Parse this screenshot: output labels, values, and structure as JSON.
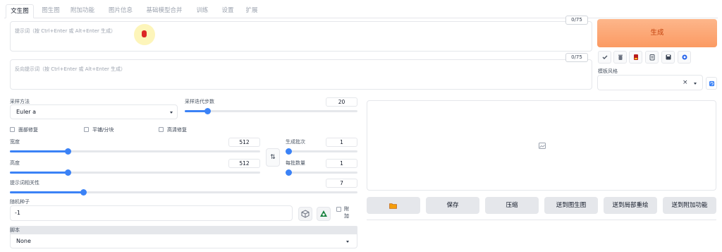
{
  "tabs": [
    {
      "label": "文生图",
      "active": true
    },
    {
      "label": "图生图"
    },
    {
      "label": "附加功能"
    },
    {
      "label": "图片信息"
    },
    {
      "label": "基础模型合并"
    },
    {
      "label": "训练"
    },
    {
      "label": "设置"
    },
    {
      "label": "扩展"
    }
  ],
  "prompt": {
    "placeholder": "提示词（按 Ctrl+Enter 或 Alt+Enter 生成）",
    "counter": "0/75"
  },
  "negative_prompt": {
    "placeholder": "反向提示词（按 Ctrl+Enter 或 Alt+Enter 生成）",
    "counter": "0/75"
  },
  "generate_button": "生成",
  "toolbar_icons": [
    "checkmark-icon",
    "trash-icon",
    "card-icon",
    "clipboard-icon",
    "save-icon",
    "refresh-icon"
  ],
  "styles": {
    "label": "模板风格",
    "clear": "×",
    "refresh_icon": "refresh-icon"
  },
  "sampler": {
    "label": "采样方法",
    "value": "Euler a"
  },
  "steps": {
    "label": "采样迭代步数",
    "value": "20",
    "progress": 0.13
  },
  "checkboxes": [
    {
      "label": "面部修复",
      "checked": false
    },
    {
      "label": "平铺/分块",
      "checked": false
    },
    {
      "label": "高清修复",
      "checked": false
    }
  ],
  "width": {
    "label": "宽度",
    "value": "512",
    "progress": 0.23
  },
  "height": {
    "label": "高度",
    "value": "512",
    "progress": 0.23
  },
  "batch_count": {
    "label": "生成批次",
    "value": "1",
    "progress": 0.0
  },
  "batch_size": {
    "label": "每批数量",
    "value": "1",
    "progress": 0.0
  },
  "cfg": {
    "label": "提示词相关性",
    "value": "7",
    "progress": 0.21
  },
  "seed": {
    "label": "随机种子",
    "value": "-1",
    "extra_label": "附加"
  },
  "script": {
    "label": "脚本",
    "value": "None"
  },
  "actions": [
    {
      "label": "",
      "icon": "folder-icon"
    },
    {
      "label": "保存"
    },
    {
      "label": "压缩"
    },
    {
      "label": "送到图生图"
    },
    {
      "label": "送到局部重绘"
    },
    {
      "label": "送到附加功能"
    }
  ],
  "colors": {
    "accent": "#3b82f6",
    "generate": "#fb9a62"
  }
}
